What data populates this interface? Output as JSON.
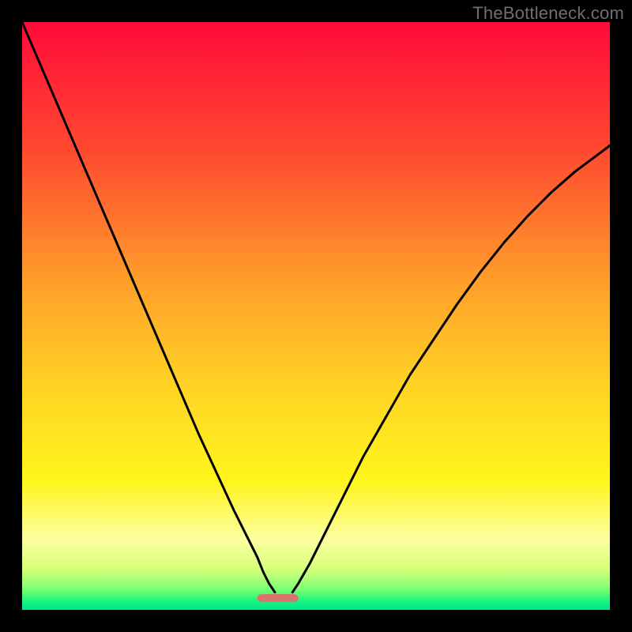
{
  "watermark": "TheBottleneck.com",
  "chart_data": {
    "type": "line",
    "title": "",
    "xlabel": "",
    "ylabel": "",
    "xlim": [
      0,
      100
    ],
    "ylim": [
      0,
      100
    ],
    "grid": false,
    "background_gradient": {
      "stops": [
        {
          "offset": 0.0,
          "color": "#ff0b3a"
        },
        {
          "offset": 0.22,
          "color": "#ff4a30"
        },
        {
          "offset": 0.45,
          "color": "#ffa22a"
        },
        {
          "offset": 0.62,
          "color": "#ffd324"
        },
        {
          "offset": 0.78,
          "color": "#fff51c"
        },
        {
          "offset": 0.88,
          "color": "#fcffa0"
        },
        {
          "offset": 0.93,
          "color": "#d8ff7a"
        },
        {
          "offset": 0.965,
          "color": "#7bff75"
        },
        {
          "offset": 0.985,
          "color": "#18f57f"
        },
        {
          "offset": 1.0,
          "color": "#00e48a"
        }
      ]
    },
    "bottleneck_marker": {
      "x_start": 40,
      "x_end": 47,
      "y": 2,
      "color": "#d9736e"
    },
    "series": [
      {
        "name": "left-curve",
        "x": [
          0,
          3,
          6,
          9,
          12,
          15,
          18,
          21,
          24,
          27,
          30,
          33,
          36,
          38,
          40,
          41,
          42,
          43
        ],
        "y": [
          100,
          93,
          86,
          79,
          72,
          65,
          58,
          51,
          44,
          37,
          30,
          23.5,
          17,
          13,
          9,
          6.5,
          4.5,
          3
        ]
      },
      {
        "name": "right-curve",
        "x": [
          46,
          47,
          49,
          52,
          55,
          58,
          62,
          66,
          70,
          74,
          78,
          82,
          86,
          90,
          94,
          98,
          100
        ],
        "y": [
          3,
          4.5,
          8,
          14,
          20,
          26,
          33,
          40,
          46,
          52,
          57.5,
          62.5,
          67,
          71,
          74.5,
          77.5,
          79
        ]
      }
    ]
  }
}
